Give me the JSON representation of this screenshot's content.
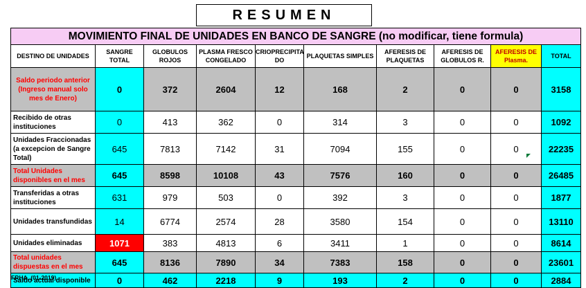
{
  "title": "RESUMEN",
  "banner": "MOVIMIENTO FINAL DE UNIDADES EN BANCO DE SANGRE (no modificar, tiene formula)",
  "headers": [
    "DESTINO DE UNIDADES",
    "SANGRE TOTAL",
    "GLOBULOS ROJOS",
    "PLASMA FRESCO CONGELADO",
    "CRIOPRECIPITA DO",
    "PLAQUETAS SIMPLES",
    "AFERESIS DE PLAQUETAS",
    "AFERESIS DE GLOBULOS R.",
    "AFERESIS DE Plasma.",
    "TOTAL"
  ],
  "rows": [
    {
      "label": "Saldo periodo anterior (Ingreso manual solo mes de Enero)",
      "values": [
        "0",
        "372",
        "2604",
        "12",
        "168",
        "2",
        "0",
        "0",
        "3158"
      ]
    },
    {
      "label": "Recibido de otras instituciones",
      "values": [
        "0",
        "413",
        "362",
        "0",
        "314",
        "3",
        "0",
        "0",
        "1092"
      ]
    },
    {
      "label": "Unidades Fraccionadas (a excepcion de Sangre Total)",
      "values": [
        "645",
        "7813",
        "7142",
        "31",
        "7094",
        "155",
        "0",
        "0",
        "22235"
      ]
    },
    {
      "label": "Total Unidades disponibles en el mes",
      "values": [
        "645",
        "8598",
        "10108",
        "43",
        "7576",
        "160",
        "0",
        "0",
        "26485"
      ]
    },
    {
      "label": "Transferidas a otras instituciones",
      "values": [
        "631",
        "979",
        "503",
        "0",
        "392",
        "3",
        "0",
        "0",
        "1877"
      ]
    },
    {
      "label": "Unidades transfundidas",
      "values": [
        "14",
        "6774",
        "2574",
        "28",
        "3580",
        "154",
        "0",
        "0",
        "13110"
      ]
    },
    {
      "label": "Unidades eliminadas",
      "values": [
        "1071",
        "383",
        "4813",
        "6",
        "3411",
        "1",
        "0",
        "0",
        "8614"
      ]
    },
    {
      "label": "Total unidades dispuestas en el mes",
      "values": [
        "645",
        "8136",
        "7890",
        "34",
        "7383",
        "158",
        "0",
        "0",
        "23601"
      ]
    },
    {
      "label": "Saldo actual disponible",
      "values": [
        "0",
        "462",
        "2218",
        "9",
        "193",
        "2",
        "0",
        "0",
        "2884"
      ]
    }
  ],
  "footer": "FRHA. (01-2019)",
  "colors": {
    "banner": "#f7ccf4",
    "cyan": "#00ffff",
    "gray": "#c0c0c0",
    "alert": "#ff0000",
    "yellow": "#ffff00",
    "label_red": "#ff0000"
  }
}
